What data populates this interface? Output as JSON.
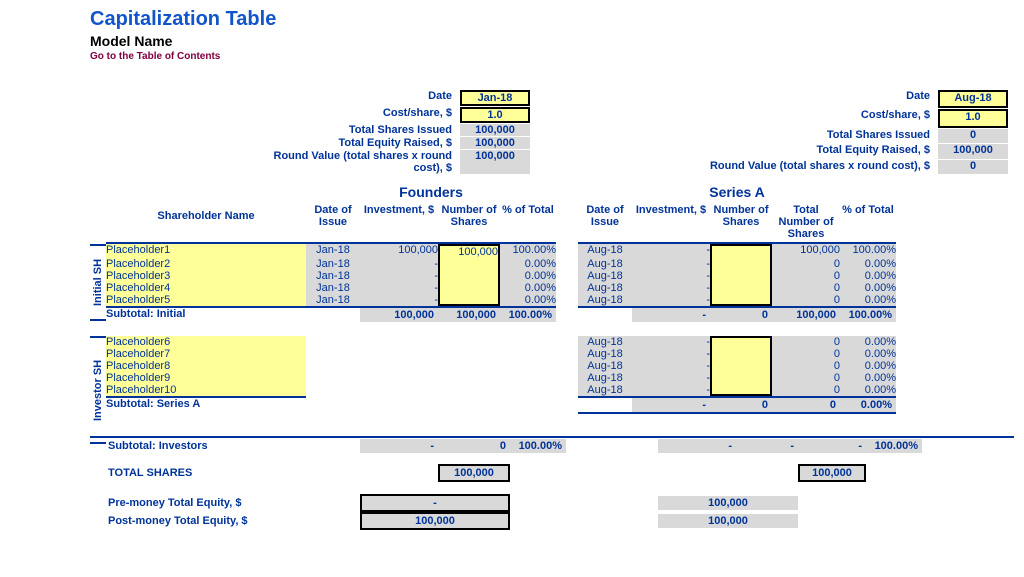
{
  "header": {
    "title": "Capitalization Table",
    "subtitle": "Model Name",
    "toc": "Go to the Table of Contents"
  },
  "metrics": {
    "labels": {
      "date": "Date",
      "cost": "Cost/share, $",
      "shares": "Total Shares Issued",
      "equity": "Total Equity Raised, $",
      "roundval": "Round Value (total shares x round cost), $"
    },
    "founders": {
      "date": "Jan-18",
      "cost": "1.0",
      "shares": "100,000",
      "equity": "100,000",
      "roundval": "100,000"
    },
    "seriesA": {
      "date": "Aug-18",
      "cost": "1.0",
      "shares": "0",
      "equity": "100,000",
      "roundval": "0"
    }
  },
  "sections": {
    "founders": "Founders",
    "seriesA": "Series A"
  },
  "columns": {
    "shareholder": "Shareholder Name",
    "dateIssue": "Date of Issue",
    "investment": "Investment, $",
    "numShares": "Number of Shares",
    "totShares": "Total Number of Shares",
    "pctTotal": "% of Total"
  },
  "vlabels": {
    "initial": "Initial SH",
    "investor": "Investor SH"
  },
  "initial": [
    {
      "name": "Placeholder1",
      "f": {
        "date": "Jan-18",
        "inv": "100,000",
        "shares": "100,000",
        "pct": "100.00%"
      },
      "s": {
        "date": "Aug-18",
        "inv": "-",
        "shares": "",
        "tot": "100,000",
        "pct": "100.00%"
      }
    },
    {
      "name": "Placeholder2",
      "f": {
        "date": "Jan-18",
        "inv": "-",
        "shares": "",
        "pct": "0.00%"
      },
      "s": {
        "date": "Aug-18",
        "inv": "-",
        "shares": "",
        "tot": "0",
        "pct": "0.00%"
      }
    },
    {
      "name": "Placeholder3",
      "f": {
        "date": "Jan-18",
        "inv": "-",
        "shares": "",
        "pct": "0.00%"
      },
      "s": {
        "date": "Aug-18",
        "inv": "-",
        "shares": "",
        "tot": "0",
        "pct": "0.00%"
      }
    },
    {
      "name": "Placeholder4",
      "f": {
        "date": "Jan-18",
        "inv": "-",
        "shares": "",
        "pct": "0.00%"
      },
      "s": {
        "date": "Aug-18",
        "inv": "-",
        "shares": "",
        "tot": "0",
        "pct": "0.00%"
      }
    },
    {
      "name": "Placeholder5",
      "f": {
        "date": "Jan-18",
        "inv": "-",
        "shares": "",
        "pct": "0.00%"
      },
      "s": {
        "date": "Aug-18",
        "inv": "-",
        "shares": "",
        "tot": "0",
        "pct": "0.00%"
      }
    }
  ],
  "initialSubtotal": {
    "label": "Subtotal: Initial",
    "f": {
      "inv": "100,000",
      "shares": "100,000",
      "pct": "100.00%"
    },
    "s": {
      "inv": "-",
      "shares": "0",
      "tot": "100,000",
      "pct": "100.00%"
    }
  },
  "investors": [
    {
      "name": "Placeholder6",
      "s": {
        "date": "Aug-18",
        "inv": "-",
        "shares": "",
        "tot": "0",
        "pct": "0.00%"
      }
    },
    {
      "name": "Placeholder7",
      "s": {
        "date": "Aug-18",
        "inv": "-",
        "shares": "",
        "tot": "0",
        "pct": "0.00%"
      }
    },
    {
      "name": "Placeholder8",
      "s": {
        "date": "Aug-18",
        "inv": "-",
        "shares": "",
        "tot": "0",
        "pct": "0.00%"
      }
    },
    {
      "name": "Placeholder9",
      "s": {
        "date": "Aug-18",
        "inv": "-",
        "shares": "",
        "tot": "0",
        "pct": "0.00%"
      }
    },
    {
      "name": "Placeholder10",
      "s": {
        "date": "Aug-18",
        "inv": "-",
        "shares": "",
        "tot": "0",
        "pct": "0.00%"
      }
    }
  ],
  "seriesSubtotal": {
    "label": "Subtotal: Series A",
    "s": {
      "inv": "-",
      "shares": "0",
      "tot": "0",
      "pct": "0.00%"
    }
  },
  "investorsSubtotal": {
    "label": "Subtotal: Investors",
    "f": {
      "inv": "-",
      "shares": "0",
      "pct": "100.00%"
    },
    "s": {
      "inv": "-",
      "shares": "-",
      "tot": "-",
      "pct": "100.00%"
    }
  },
  "totals": {
    "totalShares": {
      "label": "TOTAL SHARES",
      "f": "100,000",
      "s": "100,000"
    },
    "preMoney": {
      "label": "Pre-money Total Equity, $",
      "f": "-",
      "s": "100,000"
    },
    "postMoney": {
      "label": "Post-money Total Equity, $",
      "f": "100,000",
      "s": "100,000"
    }
  }
}
